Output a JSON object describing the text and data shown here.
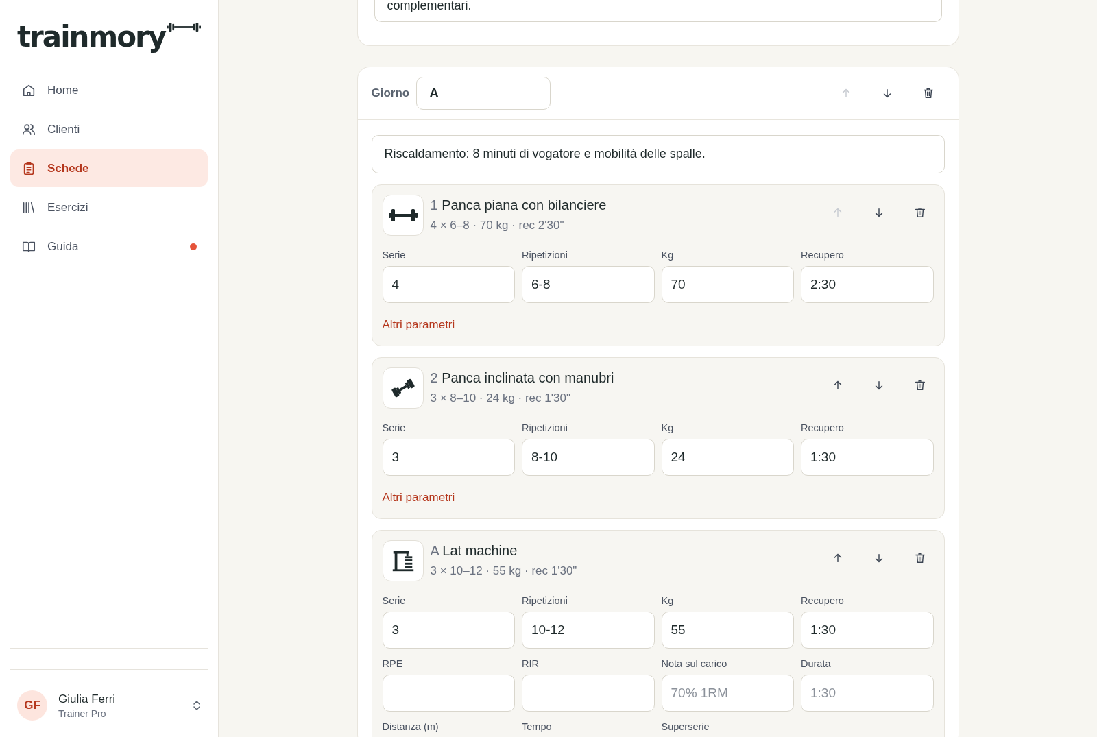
{
  "brand": {
    "name": "trainmory"
  },
  "nav": [
    {
      "label": "Home",
      "selected": false,
      "notification": false
    },
    {
      "label": "Clienti",
      "selected": false,
      "notification": false
    },
    {
      "label": "Schede",
      "selected": true,
      "notification": false
    },
    {
      "label": "Esercizi",
      "selected": false,
      "notification": false
    },
    {
      "label": "Guida",
      "selected": false,
      "notification": true
    }
  ],
  "user": {
    "initials": "GF",
    "name": "Giulia Ferri",
    "role": "Trainer Pro"
  },
  "intro_note": {
    "value": "complementari."
  },
  "day": {
    "label": "Giorno",
    "value": "A",
    "up_disabled": true,
    "note": "Riscaldamento: 8 minuti di vogatore e mobilità delle spalle.",
    "exercises": [
      {
        "index": "1",
        "name": "Panca piana con bilanciere",
        "summary": "4 × 6–8 · 70 kg · rec 2'30\"",
        "up_disabled": true,
        "link": "Altri parametri",
        "fields": [
          {
            "kind": "input",
            "label": "Serie",
            "value": "4"
          },
          {
            "kind": "input",
            "label": "Ripetizioni",
            "value": "6-8"
          },
          {
            "kind": "input",
            "label": "Kg",
            "value": "70"
          },
          {
            "kind": "input",
            "label": "Recupero",
            "value": "2:30"
          }
        ]
      },
      {
        "index": "2",
        "name": "Panca inclinata con manubri",
        "summary": "3 × 8–10 · 24 kg · rec 1'30\"",
        "up_disabled": false,
        "link": "Altri parametri",
        "fields": [
          {
            "kind": "input",
            "label": "Serie",
            "value": "3"
          },
          {
            "kind": "input",
            "label": "Ripetizioni",
            "value": "8-10"
          },
          {
            "kind": "input",
            "label": "Kg",
            "value": "24"
          },
          {
            "kind": "input",
            "label": "Recupero",
            "value": "1:30"
          }
        ]
      },
      {
        "index": "A",
        "name": "Lat machine",
        "summary": "3 × 10–12 · 55 kg · rec 1'30\"",
        "up_disabled": false,
        "fields": [
          {
            "kind": "input",
            "label": "Serie",
            "value": "3"
          },
          {
            "kind": "input",
            "label": "Ripetizioni",
            "value": "10-12"
          },
          {
            "kind": "input",
            "label": "Kg",
            "value": "55"
          },
          {
            "kind": "input",
            "label": "Recupero",
            "value": "1:30"
          },
          {
            "kind": "input",
            "label": "RPE"
          },
          {
            "kind": "input",
            "label": "RIR"
          },
          {
            "kind": "input",
            "label": "Nota sul carico",
            "placeholder": "70% 1RM"
          },
          {
            "kind": "input",
            "label": "Durata",
            "placeholder": "1:30"
          },
          {
            "kind": "label",
            "label": "Distanza (m)"
          },
          {
            "kind": "label",
            "label": "Tempo"
          },
          {
            "kind": "label",
            "label": "Superserie"
          }
        ]
      }
    ]
  }
}
